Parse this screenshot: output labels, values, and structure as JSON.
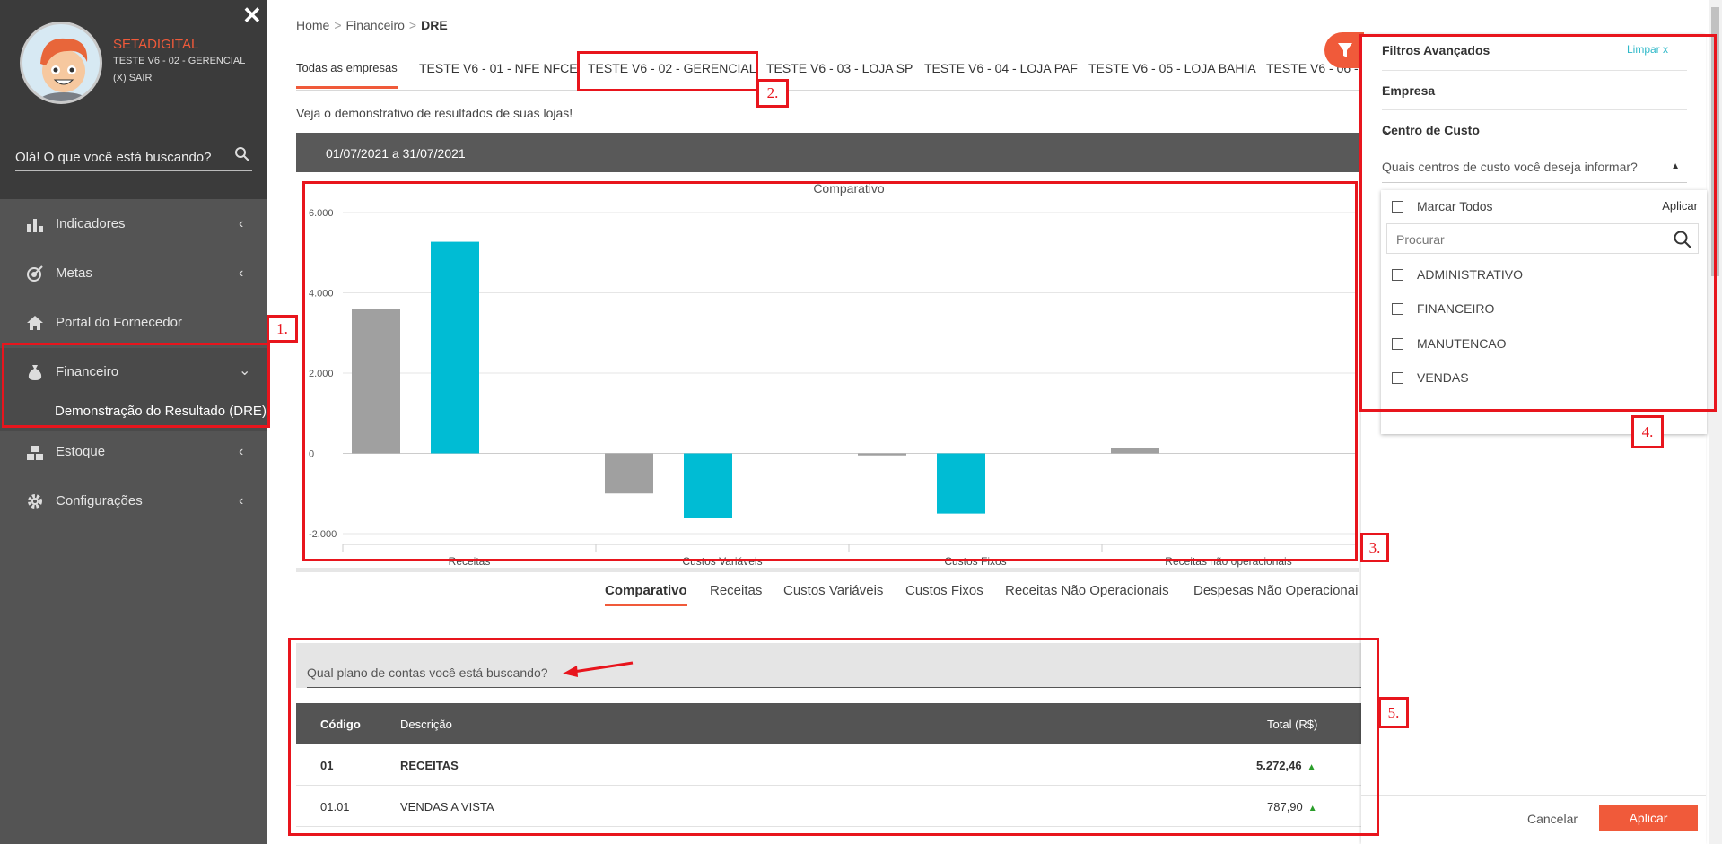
{
  "sidebar": {
    "brand": "SETADIGITAL",
    "store_name": "TESTE V6 - 02 - GERENCIAL",
    "logout": "(X) SAIR",
    "search_placeholder": "Olá! O que você está buscando?",
    "items": [
      {
        "label": "Indicadores"
      },
      {
        "label": "Metas"
      },
      {
        "label": "Portal do Fornecedor"
      },
      {
        "label": "Financeiro"
      },
      {
        "label": "Estoque"
      },
      {
        "label": "Configurações"
      }
    ],
    "sub_item": "Demonstração do Resultado (DRE)"
  },
  "breadcrumb": {
    "home": "Home",
    "section": "Financeiro",
    "current": "DRE",
    "sep": ">"
  },
  "company_tabs": [
    "Todas as empresas",
    "TESTE V6 - 01 - NFE NFCE",
    "TESTE V6 - 02 - GERENCIAL",
    "TESTE V6 - 03 - LOJA SP",
    "TESTE V6 - 04 - LOJA PAF",
    "TESTE V6 - 05 - LOJA BAHIA",
    "TESTE V6 - 06 -"
  ],
  "subtitle": "Veja o demonstrativo de resultados de suas lojas!",
  "date_range": "01/07/2021 a 31/07/2021",
  "chart_data": {
    "type": "bar",
    "title": "Comparativo",
    "categories": [
      "Receitas",
      "Custos Variáveis",
      "Custos Fixos",
      "Receitas não operacionais"
    ],
    "series": [
      {
        "values": [
          3600,
          -1000,
          -50,
          130
        ],
        "color": "#a0a0a0"
      },
      {
        "values": [
          5272,
          -1620,
          -1500,
          null
        ],
        "color": "#00bcd4"
      }
    ],
    "yticks": [
      "6.000",
      "4.000",
      "2.000",
      "0",
      "-2.000"
    ],
    "ylim": [
      -2000,
      6000
    ],
    "grid": true
  },
  "report_tabs": [
    "Comparativo",
    "Receitas",
    "Custos Variáveis",
    "Custos Fixos",
    "Receitas Não Operacionais",
    "Despesas Não Operacionai"
  ],
  "plan_search_placeholder": "Qual plano de contas você está buscando?",
  "table": {
    "headers": [
      "Código",
      "Descrição",
      "Total (R$)"
    ],
    "rows": [
      {
        "code": "01",
        "desc": "RECEITAS",
        "total": "5.272,46"
      },
      {
        "code": "01.01",
        "desc": "VENDAS A VISTA",
        "total": "787,90"
      }
    ]
  },
  "filters": {
    "title": "Filtros Avançados",
    "clear": "Limpar x",
    "empresa": "Empresa",
    "centro": "Centro de Custo",
    "question": "Quais centros de custo você deseja informar?",
    "select_all": "Marcar Todos",
    "apply_small": "Aplicar",
    "search_placeholder": "Procurar",
    "options": [
      "ADMINISTRATIVO",
      "FINANCEIRO",
      "MANUTENCAO",
      "VENDAS"
    ],
    "cancel": "Cancelar",
    "apply": "Aplicar"
  },
  "annotations": [
    "1.",
    "2.",
    "3.",
    "4.",
    "5."
  ],
  "colors": {
    "accent": "#f05a3a",
    "teal": "#00bcd4",
    "annotation": "#e8151d"
  }
}
